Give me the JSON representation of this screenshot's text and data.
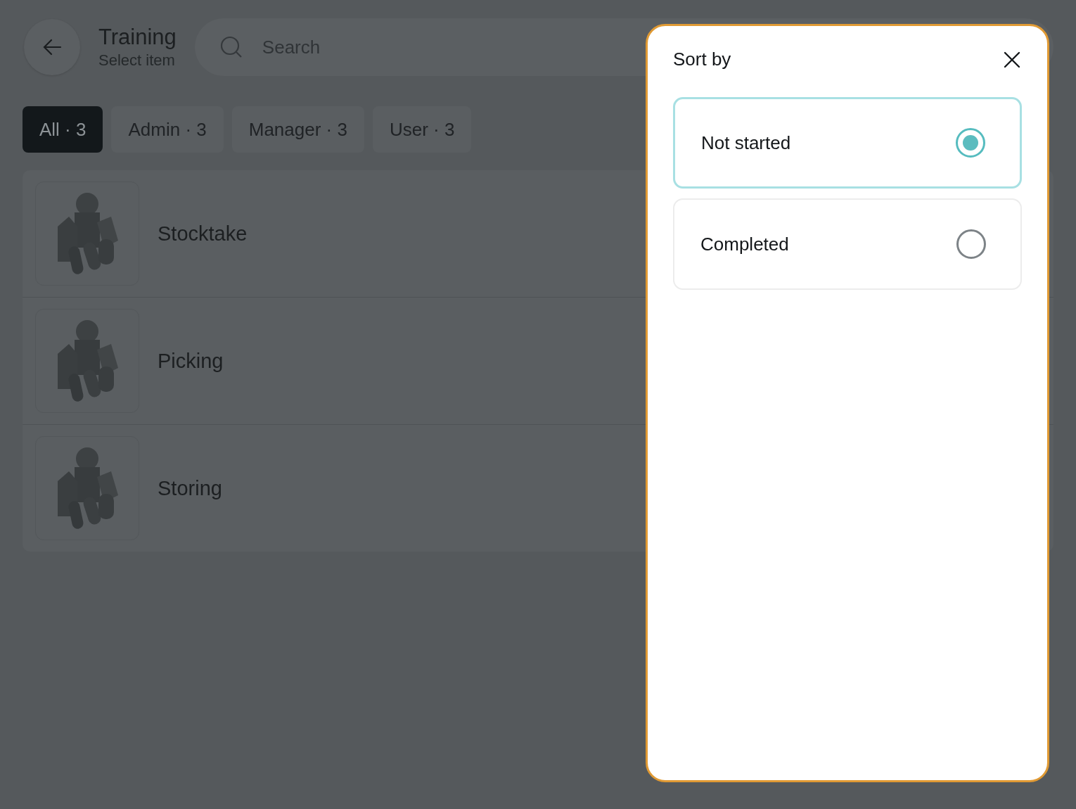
{
  "header": {
    "title": "Training",
    "subtitle": "Select item",
    "search": {
      "placeholder": "Search"
    }
  },
  "filters": [
    {
      "label": "All · 3",
      "selected": true
    },
    {
      "label": "Admin · 3",
      "selected": false
    },
    {
      "label": "Manager · 3",
      "selected": false
    },
    {
      "label": "User · 3",
      "selected": false
    }
  ],
  "items": [
    {
      "name": "Stocktake"
    },
    {
      "name": "Picking"
    },
    {
      "name": "Storing"
    }
  ],
  "sort_panel": {
    "title": "Sort by",
    "options": [
      {
        "label": "Not started",
        "selected": true
      },
      {
        "label": "Completed",
        "selected": false
      }
    ]
  }
}
